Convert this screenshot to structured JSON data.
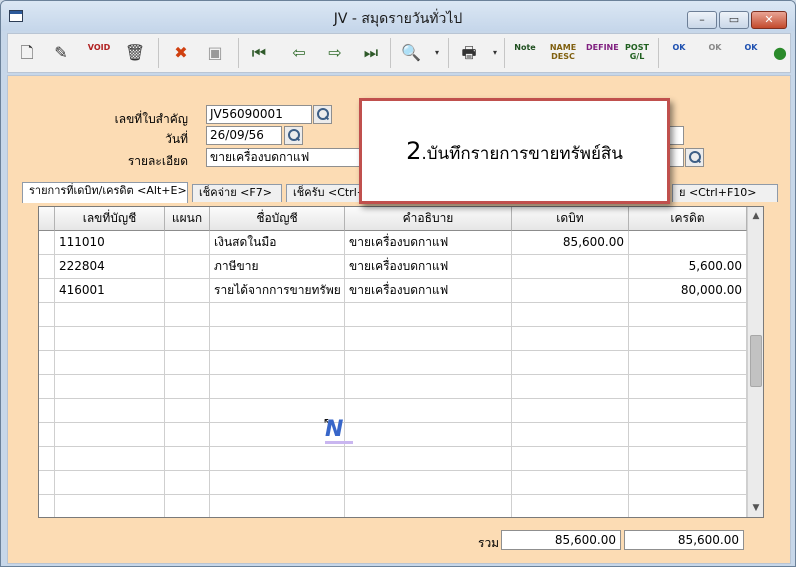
{
  "window": {
    "title": "JV - สมุดรายวันทั่วไป",
    "min_symbol": "–",
    "max_symbol": "▭",
    "close_symbol": "✕"
  },
  "toolbar": {
    "buttons": [
      {
        "name": "new-document",
        "glyph": "🗋"
      },
      {
        "name": "edit",
        "glyph": "✎"
      },
      {
        "name": "void",
        "glyph": "VOID"
      },
      {
        "name": "delete",
        "glyph": "🗑"
      },
      {
        "name": "cancel",
        "glyph": "✖"
      },
      {
        "name": "save",
        "glyph": "▣"
      },
      {
        "name": "first-record",
        "glyph": "⏮"
      },
      {
        "name": "previous-record",
        "glyph": "⇦"
      },
      {
        "name": "next-record",
        "glyph": "⇨"
      },
      {
        "name": "last-record",
        "glyph": "⏭"
      },
      {
        "name": "find",
        "glyph": "🔍"
      },
      {
        "name": "print",
        "glyph": "🖶"
      },
      {
        "name": "note",
        "glyph": "Note"
      },
      {
        "name": "name-desc",
        "glyph": "NAME DESC"
      },
      {
        "name": "define",
        "glyph": "DEFINE"
      },
      {
        "name": "post-gl",
        "glyph": "POST G/L"
      },
      {
        "name": "approve-ok",
        "glyph": "OK"
      },
      {
        "name": "unapprove",
        "glyph": "OK"
      },
      {
        "name": "document-ok",
        "glyph": "OK"
      },
      {
        "name": "exit",
        "glyph": "●"
      }
    ],
    "dropdown_symbol": "▾"
  },
  "form": {
    "doc_no_label": "เลขที่ใบสำคัญ",
    "doc_no_value": "JV56090001",
    "date_label": "วันที่",
    "date_value": "26/09/56",
    "detail_label": "รายละเอียด",
    "detail_value": "ขายเครื่องบดกาแฟ"
  },
  "tabs": [
    "รายการที่เดบิท/เครดิต <Alt+E>",
    "เช็คจ่าย <F7>",
    "เช็ครับ <Ctrl+F",
    "ย <Ctrl+F10>"
  ],
  "grid": {
    "headers": [
      "เลขที่บัญชี",
      "แผนก",
      "ชื่อบัญชี",
      "คำอธิบาย",
      "เดบิท",
      "เครดิต"
    ],
    "rows": [
      [
        "111010",
        "",
        "เงินสดในมือ",
        "ขายเครื่องบดกาแฟ",
        "85,600.00",
        ""
      ],
      [
        "222804",
        "",
        "ภาษีขาย",
        "ขายเครื่องบดกาแฟ",
        "",
        "5,600.00"
      ],
      [
        "416001",
        "",
        "รายได้จากการขายทรัพย",
        "ขายเครื่องบดกาแฟ",
        "",
        "80,000.00"
      ]
    ],
    "scroll_up": "▲",
    "scroll_down": "▼"
  },
  "totals": {
    "label": "รวม",
    "debit": "85,600.00",
    "credit": "85,600.00"
  },
  "callout": {
    "number": "2",
    "text": ".บันทึกรายการขายทรัพย์สิน"
  },
  "watermark": {
    "glyph": "N",
    "cursor": "↖"
  }
}
